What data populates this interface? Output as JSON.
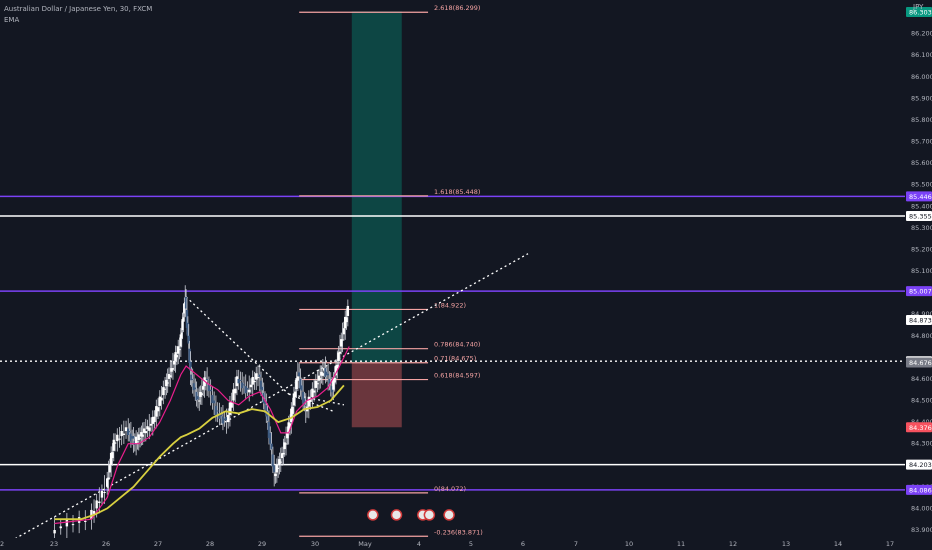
{
  "header": {
    "symbol_line": "Australian Dollar / Japanese Yen, 30, FXCM",
    "indicator": "EMA",
    "currency": "JPY"
  },
  "chart_data": {
    "type": "line",
    "title": "Australian Dollar / Japanese Yen, 30, FXCM",
    "ylim": [
      83.9,
      86.35
    ],
    "y_ticks": [
      "86.300",
      "86.200",
      "86.100",
      "86.000",
      "85.900",
      "85.800",
      "85.700",
      "85.600",
      "85.500",
      "85.400",
      "85.300",
      "85.200",
      "85.100",
      "85.000",
      "84.900",
      "84.800",
      "84.600",
      "84.500",
      "84.400",
      "84.300",
      "84.200",
      "84.100",
      "84.000",
      "83.900"
    ],
    "x_ticks": [
      "2",
      "23",
      "26",
      "27",
      "28",
      "29",
      "30",
      "May",
      "4",
      "5",
      "6",
      "7",
      "10",
      "11",
      "12",
      "13",
      "14",
      "17"
    ],
    "series": [
      {
        "name": "",
        "color": "#ffffff",
        "role": "price",
        "x": [
          24.0,
          25.4,
          26.0,
          26.3,
          26.8,
          27.1,
          27.4,
          27.8,
          28.2,
          28.5,
          28.8,
          29.0,
          29.2,
          29.5,
          29.8,
          30.2,
          30.6,
          31.0,
          31.4,
          31.8,
          32.1,
          32.4,
          32.7,
          33.0,
          33.3,
          33.6,
          34.0,
          34.3,
          34.6,
          34.9,
          35.2
        ],
        "y": [
          83.9,
          83.95,
          84.1,
          84.3,
          84.37,
          84.3,
          84.35,
          84.4,
          84.55,
          84.65,
          84.75,
          84.98,
          84.62,
          84.5,
          84.6,
          84.45,
          84.4,
          84.6,
          84.55,
          84.62,
          84.45,
          84.15,
          84.25,
          84.4,
          84.63,
          84.45,
          84.58,
          84.65,
          84.55,
          84.75,
          84.92
        ]
      },
      {
        "name": "",
        "color": "#e91e8c",
        "role": "ema-fast",
        "x": [
          24.0,
          25.4,
          26.0,
          26.4,
          26.8,
          27.2,
          27.6,
          28.0,
          28.4,
          28.8,
          29.0,
          29.4,
          29.8,
          30.2,
          30.6,
          31.0,
          31.4,
          31.8,
          32.2,
          32.6,
          32.9,
          33.2,
          33.6,
          34.0,
          34.4,
          34.8,
          35.2
        ],
        "y": [
          83.93,
          83.95,
          84.05,
          84.2,
          84.3,
          84.3,
          84.33,
          84.4,
          84.5,
          84.62,
          84.66,
          84.62,
          84.58,
          84.55,
          84.5,
          84.48,
          84.52,
          84.54,
          84.46,
          84.35,
          84.35,
          84.45,
          84.5,
          84.52,
          84.56,
          84.65,
          84.75
        ]
      },
      {
        "name": "",
        "color": "#d8d040",
        "role": "ema-slow",
        "x": [
          24.0,
          25.0,
          25.5,
          26.0,
          26.5,
          27.0,
          27.5,
          28.0,
          28.5,
          28.8,
          29.0,
          29.5,
          30.0,
          30.5,
          31.0,
          31.5,
          32.0,
          32.5,
          33.0,
          33.5,
          34.0,
          34.5,
          35.0
        ],
        "y": [
          83.95,
          83.95,
          83.97,
          84.0,
          84.05,
          84.1,
          84.17,
          84.24,
          84.3,
          84.33,
          84.34,
          84.37,
          84.42,
          84.45,
          84.44,
          84.46,
          84.45,
          84.4,
          84.42,
          84.46,
          84.47,
          84.5,
          84.57
        ]
      }
    ],
    "horizontal_lines": [
      {
        "value": 85.446,
        "color": "#7b42f6",
        "label": "85.446"
      },
      {
        "value": 85.355,
        "color": "#ffffff",
        "label": "85.355"
      },
      {
        "value": 85.007,
        "color": "#7b42f6",
        "label": "85.007"
      },
      {
        "value": 84.203,
        "color": "#ffffff",
        "label": "84.203"
      },
      {
        "value": 84.086,
        "color": "#7b42f6",
        "label": "84.086"
      },
      {
        "value": 84.682,
        "color": "#ffffff",
        "label": "84.682",
        "style": "dotted"
      }
    ],
    "price_badges": [
      {
        "value": 86.3,
        "label": "86.303",
        "color": "#089981"
      },
      {
        "value": 84.873,
        "label": "84.873",
        "color": "#ffffff"
      },
      {
        "value": 84.676,
        "label": "84.676",
        "color": "#787b86"
      },
      {
        "value": 84.376,
        "label": "84.376",
        "color": "#f7525f"
      }
    ],
    "fibonacci": [
      {
        "label": "2.618(86.299)",
        "value": 86.299
      },
      {
        "label": "1.618(85.448)",
        "value": 85.448
      },
      {
        "label": "1(84.922)",
        "value": 84.922
      },
      {
        "label": "0.786(84.740)",
        "value": 84.74
      },
      {
        "label": "0.71(84.675)",
        "value": 84.675
      },
      {
        "label": "0.618(84.597)",
        "value": 84.597
      },
      {
        "label": "0(84.072)",
        "value": 84.072
      },
      {
        "label": "-0.236(83.871)",
        "value": 83.871
      }
    ],
    "fib_x_range": [
      33.3,
      38.2
    ],
    "position": {
      "x_range": [
        35.3,
        37.2
      ],
      "entry": 84.676,
      "target": 86.303,
      "stop": 84.376,
      "profit_color": "#0d4f4a",
      "loss_color": "#7a3c42"
    },
    "trend_lines": [
      {
        "from": [
          29.0,
          84.98
        ],
        "to": [
          32.9,
          84.53
        ]
      },
      {
        "from": [
          32.9,
          84.53
        ],
        "to": [
          34.6,
          84.45
        ]
      },
      {
        "from": [
          22.5,
          83.86
        ],
        "to": [
          42.0,
          85.18
        ]
      },
      {
        "from": [
          32.9,
          84.53
        ],
        "to": [
          35.0,
          84.48
        ]
      }
    ],
    "event_markers": [
      {
        "x": 36.1,
        "value": 83.97
      },
      {
        "x": 37.0,
        "value": 83.97
      },
      {
        "x": 38.0,
        "value": 83.97
      },
      {
        "x": 38.25,
        "value": 83.97
      },
      {
        "x": 39.0,
        "value": 83.97
      }
    ]
  }
}
